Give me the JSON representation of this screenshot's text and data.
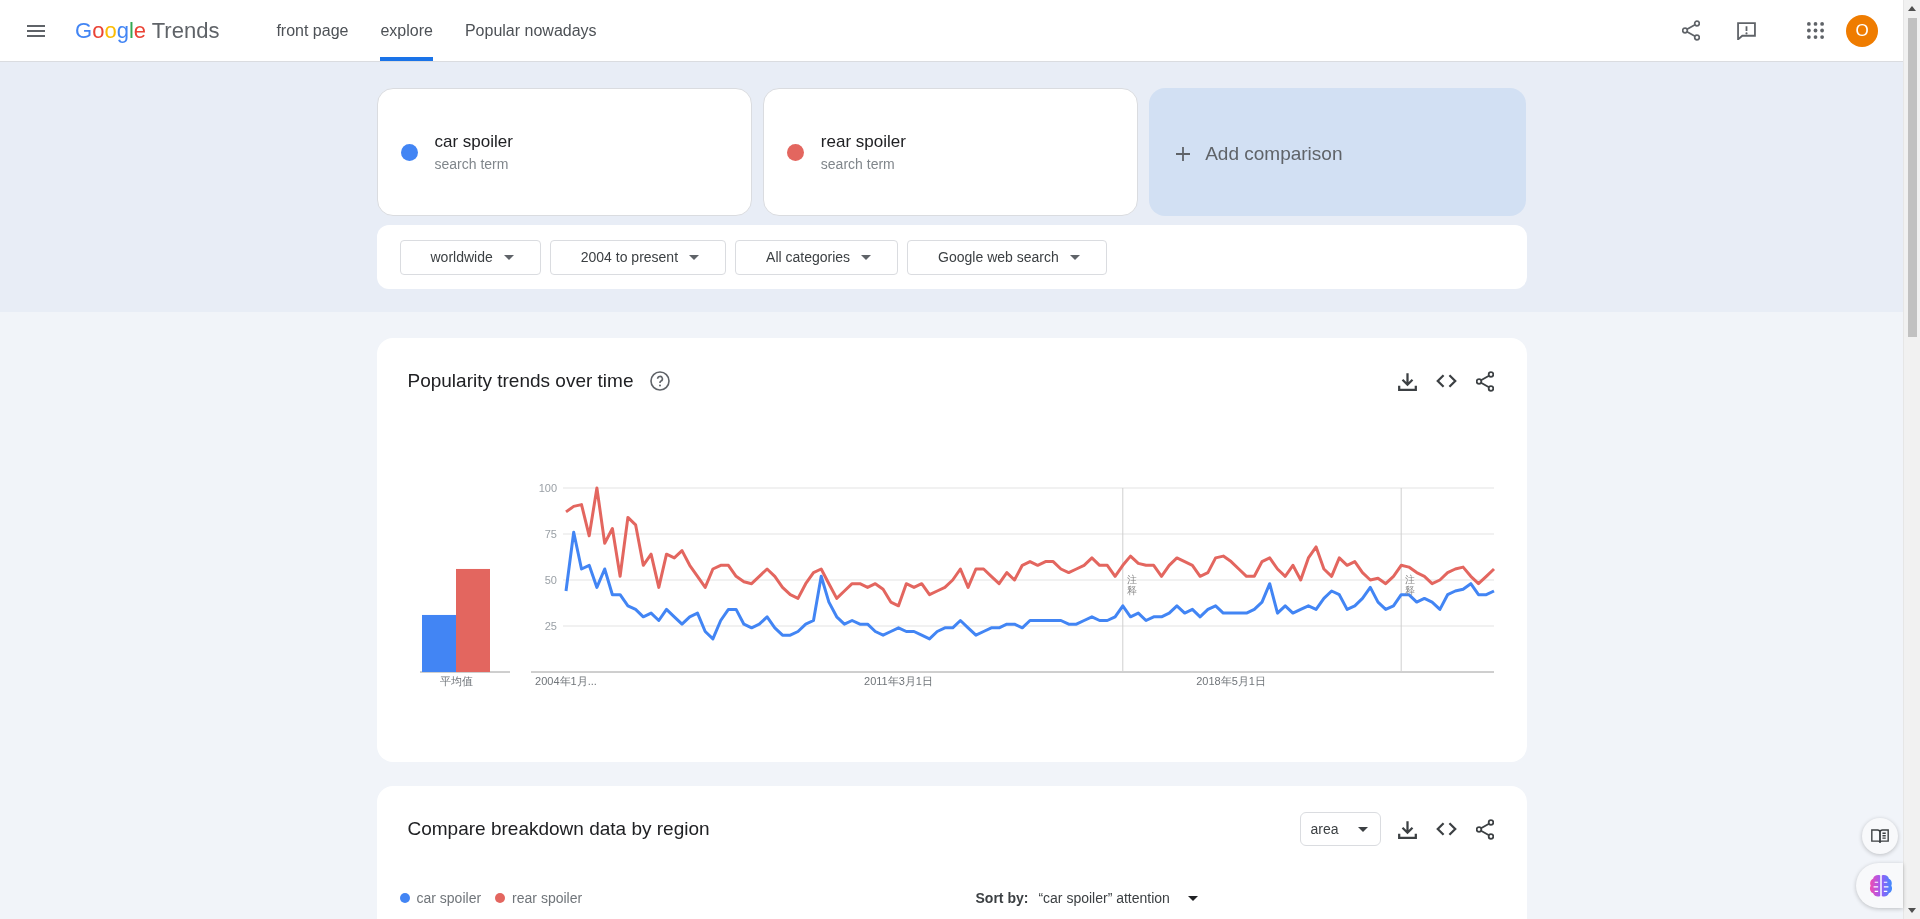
{
  "header": {
    "logo": {
      "brand": "Google",
      "product": "Trends"
    },
    "nav": [
      {
        "label": "front page",
        "selected": false
      },
      {
        "label": "explore",
        "selected": true
      },
      {
        "label": "Popular nowadays",
        "selected": false
      }
    ],
    "avatar": {
      "initial": "O"
    }
  },
  "terms": [
    {
      "term": "car spoiler",
      "caption": "search term",
      "color": "#4285f4"
    },
    {
      "term": "rear spoiler",
      "caption": "search term",
      "color": "#e3665f"
    }
  ],
  "add_comparison": {
    "label": "Add comparison"
  },
  "filters": [
    {
      "label": "worldwide"
    },
    {
      "label": "2004 to present"
    },
    {
      "label": "All categories"
    },
    {
      "label": "Google web search"
    }
  ],
  "interest_over_time": {
    "title": "Popularity trends over time",
    "average": {
      "chart_data": {
        "type": "bar",
        "categories": [
          "平均值"
        ],
        "series": [
          {
            "color": "#4285f4",
            "values": [
              31
            ]
          },
          {
            "color": "#e3665f",
            "values": [
              56
            ]
          }
        ],
        "ylim": [
          0,
          100
        ]
      }
    },
    "chart_data": {
      "type": "line",
      "categories": [
        "2004年1月...",
        null,
        null,
        null,
        null,
        null,
        null,
        null,
        null,
        null,
        null,
        null,
        null,
        null,
        null,
        null,
        null,
        null,
        null,
        null,
        null,
        null,
        null,
        null,
        null,
        null,
        null,
        null,
        null,
        null,
        null,
        null,
        null,
        null,
        null,
        null,
        null,
        null,
        null,
        null,
        null,
        null,
        null,
        "2011年3月1日",
        null,
        null,
        null,
        null,
        null,
        null,
        null,
        null,
        null,
        null,
        null,
        null,
        null,
        null,
        null,
        null,
        null,
        null,
        null,
        null,
        null,
        null,
        null,
        null,
        null,
        null,
        null,
        null,
        null,
        null,
        null,
        null,
        null,
        null,
        null,
        null,
        null,
        null,
        null,
        null,
        null,
        null,
        "2018年5月1日",
        null,
        null,
        null,
        null,
        null,
        null,
        null,
        null,
        null,
        null,
        null,
        null,
        null,
        null,
        null,
        null,
        null,
        null,
        null,
        null,
        null,
        null,
        null,
        null,
        null,
        null,
        null,
        null,
        null,
        null,
        null,
        null,
        null,
        null
      ],
      "series": [
        {
          "color": "#4285f4",
          "values": [
            44,
            76,
            56,
            58,
            46,
            56,
            42,
            42,
            36,
            34,
            30,
            32,
            28,
            34,
            30,
            26,
            30,
            32,
            22,
            18,
            28,
            34,
            34,
            26,
            24,
            26,
            30,
            24,
            20,
            20,
            22,
            26,
            28,
            52,
            38,
            30,
            26,
            28,
            26,
            26,
            22,
            20,
            22,
            24,
            22,
            22,
            20,
            18,
            22,
            24,
            24,
            28,
            24,
            20,
            22,
            24,
            24,
            26,
            26,
            24,
            28,
            28,
            28,
            28,
            28,
            26,
            26,
            28,
            30,
            28,
            28,
            30,
            36,
            30,
            32,
            28,
            30,
            30,
            32,
            36,
            32,
            34,
            30,
            34,
            36,
            32,
            32,
            32,
            32,
            34,
            38,
            48,
            32,
            36,
            32,
            34,
            36,
            34,
            40,
            44,
            42,
            34,
            36,
            40,
            46,
            38,
            34,
            36,
            42,
            42,
            38,
            40,
            38,
            34,
            42,
            44,
            45,
            48,
            42,
            42,
            44
          ]
        },
        {
          "color": "#e3665f",
          "values": [
            87,
            90,
            91,
            74,
            100,
            70,
            78,
            52,
            84,
            80,
            58,
            64,
            46,
            64,
            62,
            66,
            58,
            52,
            46,
            56,
            58,
            58,
            52,
            49,
            48,
            52,
            56,
            52,
            46,
            42,
            40,
            48,
            54,
            56,
            48,
            40,
            44,
            48,
            48,
            46,
            48,
            45,
            38,
            36,
            48,
            46,
            48,
            42,
            44,
            46,
            50,
            56,
            46,
            56,
            56,
            52,
            48,
            54,
            50,
            58,
            60,
            58,
            60,
            60,
            56,
            54,
            56,
            58,
            62,
            58,
            58,
            52,
            58,
            63,
            59,
            58,
            58,
            52,
            58,
            62,
            60,
            58,
            52,
            54,
            62,
            63,
            60,
            56,
            52,
            52,
            60,
            62,
            56,
            52,
            58,
            50,
            62,
            68,
            56,
            52,
            62,
            58,
            60,
            54,
            50,
            51,
            48,
            52,
            58,
            57,
            54,
            52,
            48,
            50,
            54,
            56,
            57,
            52,
            48,
            52,
            56
          ]
        }
      ],
      "ylim": [
        0,
        100
      ],
      "yticks": [
        25,
        50,
        75,
        100
      ],
      "grid": true,
      "annotations": [
        "注释",
        "注释"
      ]
    }
  },
  "region_breakdown": {
    "title": "Compare breakdown data by region",
    "resolution": "area",
    "legend": [
      {
        "name": "car spoiler",
        "color": "#4285f4"
      },
      {
        "name": "rear spoiler",
        "color": "#e3665f"
      }
    ],
    "sort": {
      "label": "Sort by:",
      "value": "“car spoiler” attention"
    }
  }
}
